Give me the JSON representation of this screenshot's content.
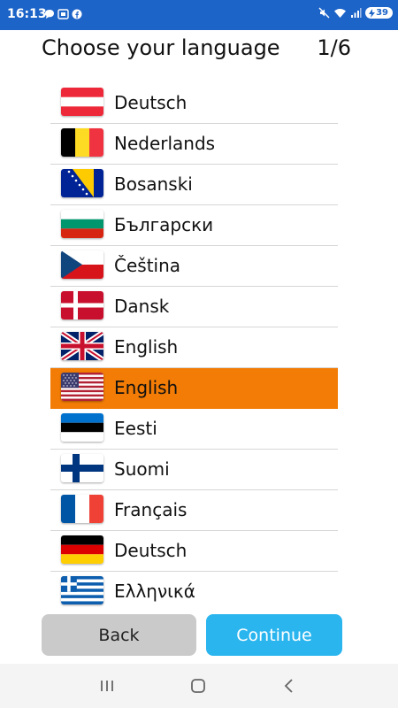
{
  "status_bar": {
    "time": "16:13",
    "battery": "39",
    "left_icons": [
      "chat-bubble-icon",
      "screenshot-icon",
      "facebook-icon"
    ],
    "right_icons": [
      "mute-icon",
      "wifi-icon",
      "signal-icon",
      "battery-icon"
    ]
  },
  "header": {
    "title": "Choose your language",
    "counter": "1/6"
  },
  "languages": [
    {
      "label": "Deutsch",
      "flag": "austria-flag-icon",
      "selected": false
    },
    {
      "label": "Nederlands",
      "flag": "belgium-flag-icon",
      "selected": false
    },
    {
      "label": "Bosanski",
      "flag": "bosnia-flag-icon",
      "selected": false
    },
    {
      "label": "Български",
      "flag": "bulgaria-flag-icon",
      "selected": false
    },
    {
      "label": "Čeština",
      "flag": "czech-flag-icon",
      "selected": false
    },
    {
      "label": "Dansk",
      "flag": "denmark-flag-icon",
      "selected": false
    },
    {
      "label": "English",
      "flag": "uk-flag-icon",
      "selected": false
    },
    {
      "label": "English",
      "flag": "usa-flag-icon",
      "selected": true
    },
    {
      "label": "Eesti",
      "flag": "estonia-flag-icon",
      "selected": false
    },
    {
      "label": "Suomi",
      "flag": "finland-flag-icon",
      "selected": false
    },
    {
      "label": "Français",
      "flag": "france-flag-icon",
      "selected": false
    },
    {
      "label": "Deutsch",
      "flag": "germany-flag-icon",
      "selected": false
    },
    {
      "label": "Ελληνικά",
      "flag": "greece-flag-icon",
      "selected": false
    }
  ],
  "buttons": {
    "back": "Back",
    "continue": "Continue"
  },
  "nav_bar": {
    "recents": "recents-icon",
    "home": "home-icon",
    "back": "back-icon"
  },
  "colors": {
    "status_bar": "#1d64c8",
    "selected_row": "#f27c05",
    "continue_button": "#2ab5ef",
    "back_button": "#cacaca"
  }
}
